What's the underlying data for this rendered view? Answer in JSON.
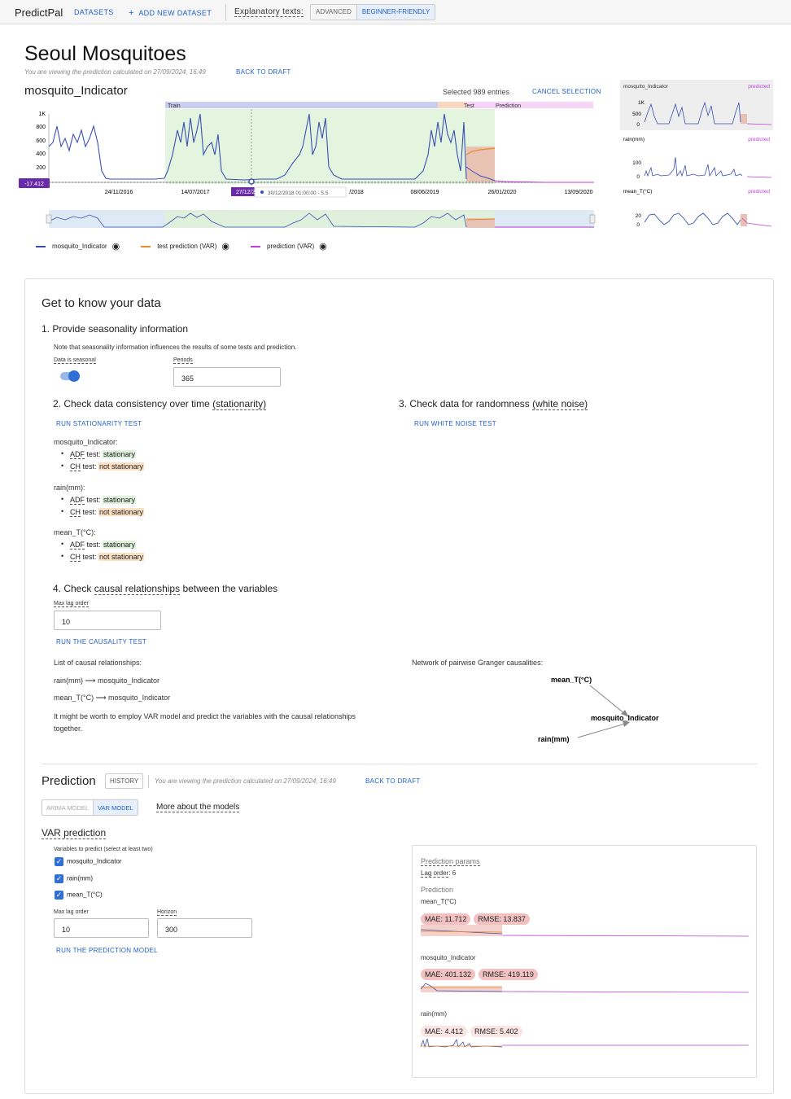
{
  "topbar": {
    "brand": "PredictPal",
    "datasets": "DATASETS",
    "add_dataset": "ADD NEW DATASET",
    "explanatory_label": "Explanatory texts:",
    "mode_advanced": "ADVANCED",
    "mode_beginner": "BEGINNER-FRIENDLY"
  },
  "page": {
    "title": "Seoul Mosquitoes",
    "viewing_note": "You are viewing the prediction calculated on 27/09/2024, 16:49",
    "back_to_draft": "BACK TO DRAFT"
  },
  "chart_main": {
    "variable": "mosquito_Indicator",
    "selected": "Selected 989 entries",
    "cancel_selection": "CANCEL SELECTION",
    "regions": [
      "Train",
      "Test",
      "Prediction"
    ],
    "y_ticks": [
      "1K",
      "800",
      "600",
      "400",
      "200"
    ],
    "x_ticks": [
      "24/11/2016",
      "14/07/2017",
      "27/12/2",
      "/2018",
      "08/06/2019",
      "26/01/2020",
      "13/09/2020"
    ],
    "cursor_value": "-17.412",
    "tooltip": "30/12/2018 01:00:00 - 5.5",
    "legend": [
      "mosquito_Indicator",
      "test prediction (VAR)",
      "prediction (VAR)"
    ]
  },
  "mini_charts": [
    {
      "name": "mosquito_Indicator",
      "tag": "predicted",
      "ticks": [
        "1K",
        "500",
        "0"
      ]
    },
    {
      "name": "rain(mm)",
      "tag": "predicted",
      "ticks": [
        "100",
        "0"
      ]
    },
    {
      "name": "mean_T(°C)",
      "tag": "predicted",
      "ticks": [
        "20",
        "0"
      ]
    }
  ],
  "know": {
    "title": "Get to know your data",
    "s1": "1. Provide seasonality information",
    "s1_note": "Note that seasonality information influences the results of some tests and prediction.",
    "seasonal_label": "Data is seasonal",
    "periods_label": "Periods",
    "periods_value": "365",
    "s2_pre": "2. Check data consistency over time ",
    "s2_term": "(stationarity)",
    "run_stationarity": "RUN STATIONARITY TEST",
    "s3_pre": "3. Check data for randomness ",
    "s3_term": "(white noise)",
    "run_white_noise": "RUN WHITE NOISE TEST",
    "stationarity": [
      {
        "var": "mosquito_Indicator:",
        "adf": "ADF",
        "adf_suffix": " test: ",
        "adf_res": "stationary",
        "ch": "CH",
        "ch_suffix": " test: ",
        "ch_res": "not stationary"
      },
      {
        "var": "rain(mm):",
        "adf": "ADF",
        "adf_suffix": " test: ",
        "adf_res": "stationary",
        "ch": "CH",
        "ch_suffix": " test: ",
        "ch_res": "not stationary"
      },
      {
        "var": "mean_T(°C):",
        "adf": "ADF",
        "adf_suffix": " test: ",
        "adf_res": "stationary",
        "ch": "CH",
        "ch_suffix": " test: ",
        "ch_res": "not stationary"
      }
    ],
    "s4_pre": "4. Check ",
    "s4_term": "causal relationships",
    "s4_post": " between the variables",
    "max_lag_label": "Max lag order",
    "max_lag_value": "10",
    "run_causality": "RUN THE CAUSALITY TEST",
    "causal_list_title": "List of causal relationships:",
    "causal": [
      {
        "from": "rain(mm)",
        "to": "mosquito_Indicator"
      },
      {
        "from": "mean_T(°C)",
        "to": "mosquito_Indicator"
      }
    ],
    "var_hint": "It might be worth to employ VAR model and predict the variables with the causal relationships together.",
    "network_title": "Network of pairwise Granger causalities:",
    "network_nodes": [
      "mean_T(°C)",
      "mosquito_Indicator",
      "rain(mm)"
    ]
  },
  "prediction": {
    "title": "Prediction",
    "history": "HISTORY",
    "viewing_note": "You are viewing the prediction calculated on 27/09/2024, 16:49",
    "back_to_draft": "BACK TO DRAFT",
    "tab_arima": "ARIMA MODEL",
    "tab_var": "VAR MODEL",
    "more_models": "More about the models",
    "var_title": "VAR prediction",
    "vars_label": "Variables to predict (select at least two)",
    "vars": [
      "mosquito_Indicator",
      "rain(mm)",
      "mean_T(°C)"
    ],
    "max_lag_label": "Max lag order",
    "max_lag_value": "10",
    "horizon_label": "Horizon",
    "horizon_value": "300",
    "run_prediction": "RUN THE PREDICTION MODEL",
    "params_title": "Prediction params",
    "lag_order_label": "Lag order",
    "lag_order_value": ": 6",
    "pred_label": "Prediction",
    "results": [
      {
        "var": "mean_T(°C)",
        "mae": "MAE: 11.712",
        "rmse": "RMSE: 13.837"
      },
      {
        "var": "mosquito_Indicator",
        "mae": "MAE: 401.132",
        "rmse": "RMSE: 419.119"
      },
      {
        "var": "rain(mm)",
        "mae": "MAE: 4.412",
        "rmse": "RMSE: 5.402"
      }
    ]
  },
  "colors": {
    "series": "#3a4fb5",
    "test": "#ee8a2a",
    "pred": "#c03ed8",
    "train_bg": "#e3f5df",
    "accent": "#1f5fd1",
    "cursor": "#6a2bab"
  }
}
